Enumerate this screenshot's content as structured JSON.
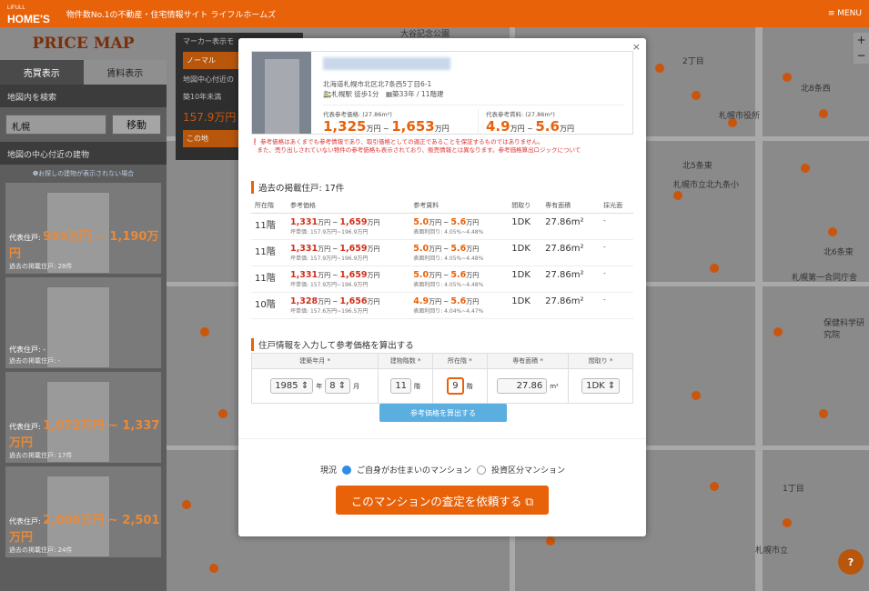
{
  "topbar": {
    "logo_small": "LIFULL",
    "logo": "HOME'S",
    "tagline": "物件数No.1の不動産・住宅情報サイト ライフルホームズ",
    "menu": "≡ MENU"
  },
  "left": {
    "logo": "PRICE MAP",
    "tabs": [
      "売買表示",
      "賃料表示"
    ],
    "search_head": "地図内を検索",
    "search_value": "札幌",
    "search_button": "移動",
    "nearby_head": "地図の中心付近の建物",
    "nearby_note": "❶お探しの建物が表示されない場合",
    "cards": [
      {
        "price_prefix": "代表住戸:",
        "price": "955万円 ~ 1,190万円",
        "sub": "過去の掲載住戸: 28件"
      },
      {
        "price_prefix": "代表住戸: -",
        "price": "",
        "sub": "過去の掲載住戸: -"
      },
      {
        "price_prefix": "代表住戸:",
        "price": "1,072万円 ~ 1,337万円",
        "sub": "過去の掲載住戸: 17件"
      },
      {
        "price_prefix": "代表住戸:",
        "price": "2,006万円 ~ 2,501万円",
        "sub": "過去の掲載住戸: 24件"
      }
    ]
  },
  "markerpanel": {
    "title": "マーカー表示モ",
    "mode": "ノーマル",
    "center": "地図中心付近の",
    "age": "築10年未満",
    "price": "157.9万円",
    "btn": "この地"
  },
  "map_labels": [
    "1丁目",
    "2丁目",
    "北8条西",
    "北6条東",
    "北5条東",
    "札幌第一合同庁舎",
    "札幌市立北九条小",
    "札幌市役所",
    "札幌市立",
    "保健科学研究院",
    "大谷記念公園"
  ],
  "modal": {
    "address": "北海道札幌市北区北7条西5丁目6-1",
    "station": "札幌駅 徒歩1分",
    "building": "築33年 / 11階建",
    "ref_price_label": "代表参考価格: (27.86m²)",
    "ref_price_low": "1,325",
    "ref_price_high": "1,653",
    "ref_rent_label": "代表参考賃料: (27.86m²)",
    "ref_rent_low": "4.9",
    "ref_rent_high": "5.6",
    "unit_man": "万円",
    "tilde": " ~ ",
    "warning1": "参考価格はあくまでも参考情報であり、取引価格としての適正であることを保証するものではありません。",
    "warning2": "また、売り出しされていない物件の参考価格も表示されており、販売情報とは異なります。参考価格算出ロジックについて",
    "hist_title": "過去の掲載住戸: 17件",
    "hist_cols": [
      "所在階",
      "参考価格",
      "参考賃料",
      "間取り",
      "専有面積",
      "採光面"
    ],
    "hist_rows": [
      {
        "floor": "11階",
        "p_low": "1,331",
        "p_high": "1,659",
        "unit_price": "坪単価: 157.9万円~196.9万円",
        "r_low": "5.0",
        "r_high": "5.6",
        "yield": "表面利回り: 4.05%~4.48%",
        "layout": "1DK",
        "area": "27.86m²",
        "light": "-"
      },
      {
        "floor": "11階",
        "p_low": "1,331",
        "p_high": "1,659",
        "unit_price": "坪単価: 157.9万円~196.9万円",
        "r_low": "5.0",
        "r_high": "5.6",
        "yield": "表面利回り: 4.05%~4.48%",
        "layout": "1DK",
        "area": "27.86m²",
        "light": "-"
      },
      {
        "floor": "11階",
        "p_low": "1,331",
        "p_high": "1,659",
        "unit_price": "坪単価: 157.9万円~196.9万円",
        "r_low": "5.0",
        "r_high": "5.6",
        "yield": "表面利回り: 4.05%~4.48%",
        "layout": "1DK",
        "area": "27.86m²",
        "light": "-"
      },
      {
        "floor": "10階",
        "p_low": "1,328",
        "p_high": "1,656",
        "unit_price": "坪単価: 157.6万円~196.5万円",
        "r_low": "4.9",
        "r_high": "5.6",
        "yield": "表面利回り: 4.04%~4.47%",
        "layout": "1DK",
        "area": "27.86m²",
        "light": "-"
      }
    ],
    "form_title": "住戸情報を入力して参考価格を算出する",
    "form_cols": [
      "建築年月 *",
      "建物階数 *",
      "所在階 *",
      "専有面積 *",
      "間取り *"
    ],
    "year": "1985",
    "year_unit": "年",
    "month": "8",
    "month_unit": "月",
    "floors": "11",
    "floors_unit": "階",
    "floor": "9",
    "floor_unit": "階",
    "area": "27.86",
    "area_unit": "m²",
    "layout": "1DK",
    "calc_button": "参考価格を算出する",
    "status_label": "現況",
    "status_opt1": "ご自身がお住まいのマンション",
    "status_opt2": "投資区分マンション",
    "cta": "このマンションの査定を依頼する ⧉"
  }
}
